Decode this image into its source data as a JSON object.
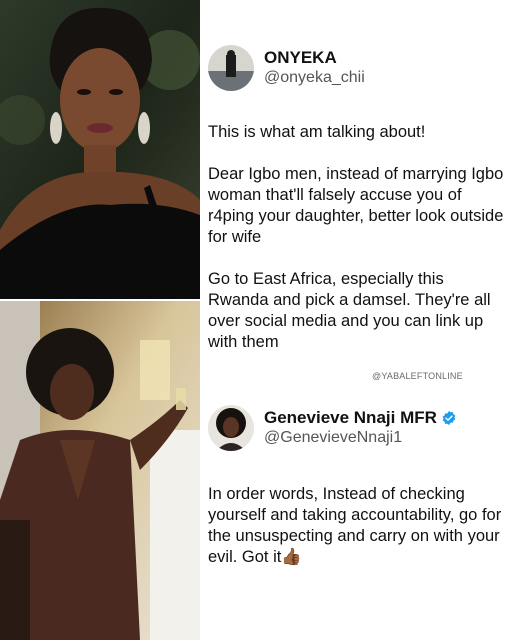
{
  "tweets": [
    {
      "display_name": "ONYEKA",
      "handle": "@onyeka_chii",
      "paragraphs": [
        "This is what am talking about!",
        "Dear Igbo men, instead of marrying Igbo woman that'll falsely accuse you of r4ping your daughter, better look outside for wife",
        "Go to East Africa, especially this Rwanda and pick a damsel. They're all over social media and you can link up with them"
      ]
    },
    {
      "display_name": "Genevieve Nnaji MFR",
      "handle": "@GenevieveNnaji1",
      "verified": true,
      "paragraphs": [
        "In order words, Instead of checking yourself and taking accountability, go for the unsuspecting and carry on with your evil. Got it👍🏾"
      ]
    }
  ],
  "watermark": "@YABALEFTONLINE",
  "colors": {
    "verified_badge": "#1d9bf0",
    "text": "#111111",
    "handle": "#555555"
  },
  "icons": [
    "verified-badge-icon",
    "avatar-photo",
    "woman-portrait-photo"
  ]
}
